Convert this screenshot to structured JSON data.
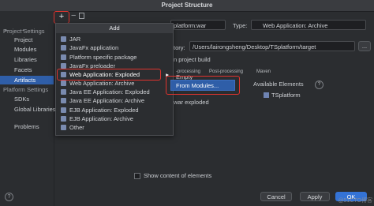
{
  "window": {
    "title": "Project Structure"
  },
  "nav": {
    "back": "←",
    "forward": "→"
  },
  "sidebar": {
    "section1": "Project Settings",
    "items": [
      "Project",
      "Modules",
      "Libraries",
      "Facets",
      "Artifacts"
    ],
    "section2": "Platform Settings",
    "items2": [
      "SDKs",
      "Global Libraries"
    ],
    "problems": "Problems"
  },
  "toolbar": {
    "add_symbol": "+",
    "remove_symbol": "−"
  },
  "add_menu": {
    "header": "Add",
    "items": [
      "JAR",
      "JavaFx application",
      "Platform specific package",
      "JavaFx preloader",
      "Web Application: Exploded",
      "Web Application: Archive",
      "Java EE Application: Exploded",
      "Java EE Application: Archive",
      "EJB Application: Exploded",
      "EJB Application: Archive",
      "Other"
    ],
    "selected_index": 4
  },
  "submenu": {
    "item": "From Modules..."
  },
  "main": {
    "name_value": "platform:war",
    "type_label": "Type:",
    "type_value": "Web Application: Archive",
    "dir_label": "tory:",
    "dir_value": "/Users/lairongsheng/Desktop/TSplatform/target",
    "build_label": "n project build",
    "tabs": [
      "Empty",
      "-processing",
      "Post-processing",
      "Maven"
    ],
    "available_label": "Available Elements",
    "help_q": "?",
    "tree_item": "TSplatform",
    "war_item": "war exploded",
    "show_content": "Show content of elements",
    "more_btn": "..."
  },
  "buttons": {
    "cancel": "Cancel",
    "apply": "Apply",
    "ok": "OK"
  },
  "watermark": "@51CTO博客"
}
